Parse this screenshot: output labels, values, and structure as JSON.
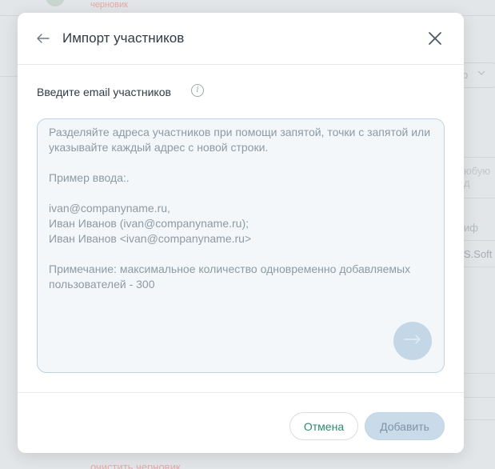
{
  "background": {
    "draft_label": "черновик",
    "select_value": "р",
    "input_placeholder": "юбую д",
    "field_label": "иф",
    "field_value": "S.Soft",
    "clear_draft_label": "очистить черновик"
  },
  "modal": {
    "title": "Импорт участников",
    "field_label": "Введите email участников",
    "info_icon_glyph": "i",
    "textarea_placeholder": "Разделяйте адреса участников при помощи запятой, точки с запятой или указывайте каждый адрес с новой строки.\n\nПример ввода:.\n\nivan@companyname.ru,\nИван Иванов (ivan@companyname.ru);\nИван Иванов <ivan@companyname.ru>\n\nПримечание: максимальное количество одновременно добавляемых пользователей - 300",
    "textarea_value": "",
    "cancel_label": "Отмена",
    "add_label": "Добавить"
  },
  "colors": {
    "accent_green": "#2e8b70",
    "disabled_blue": "#c9dae8",
    "draft_red": "#e6a8a8"
  },
  "icons": {
    "back": "arrow-left-icon",
    "close": "close-icon",
    "info": "info-icon",
    "submit": "arrow-right-icon"
  }
}
